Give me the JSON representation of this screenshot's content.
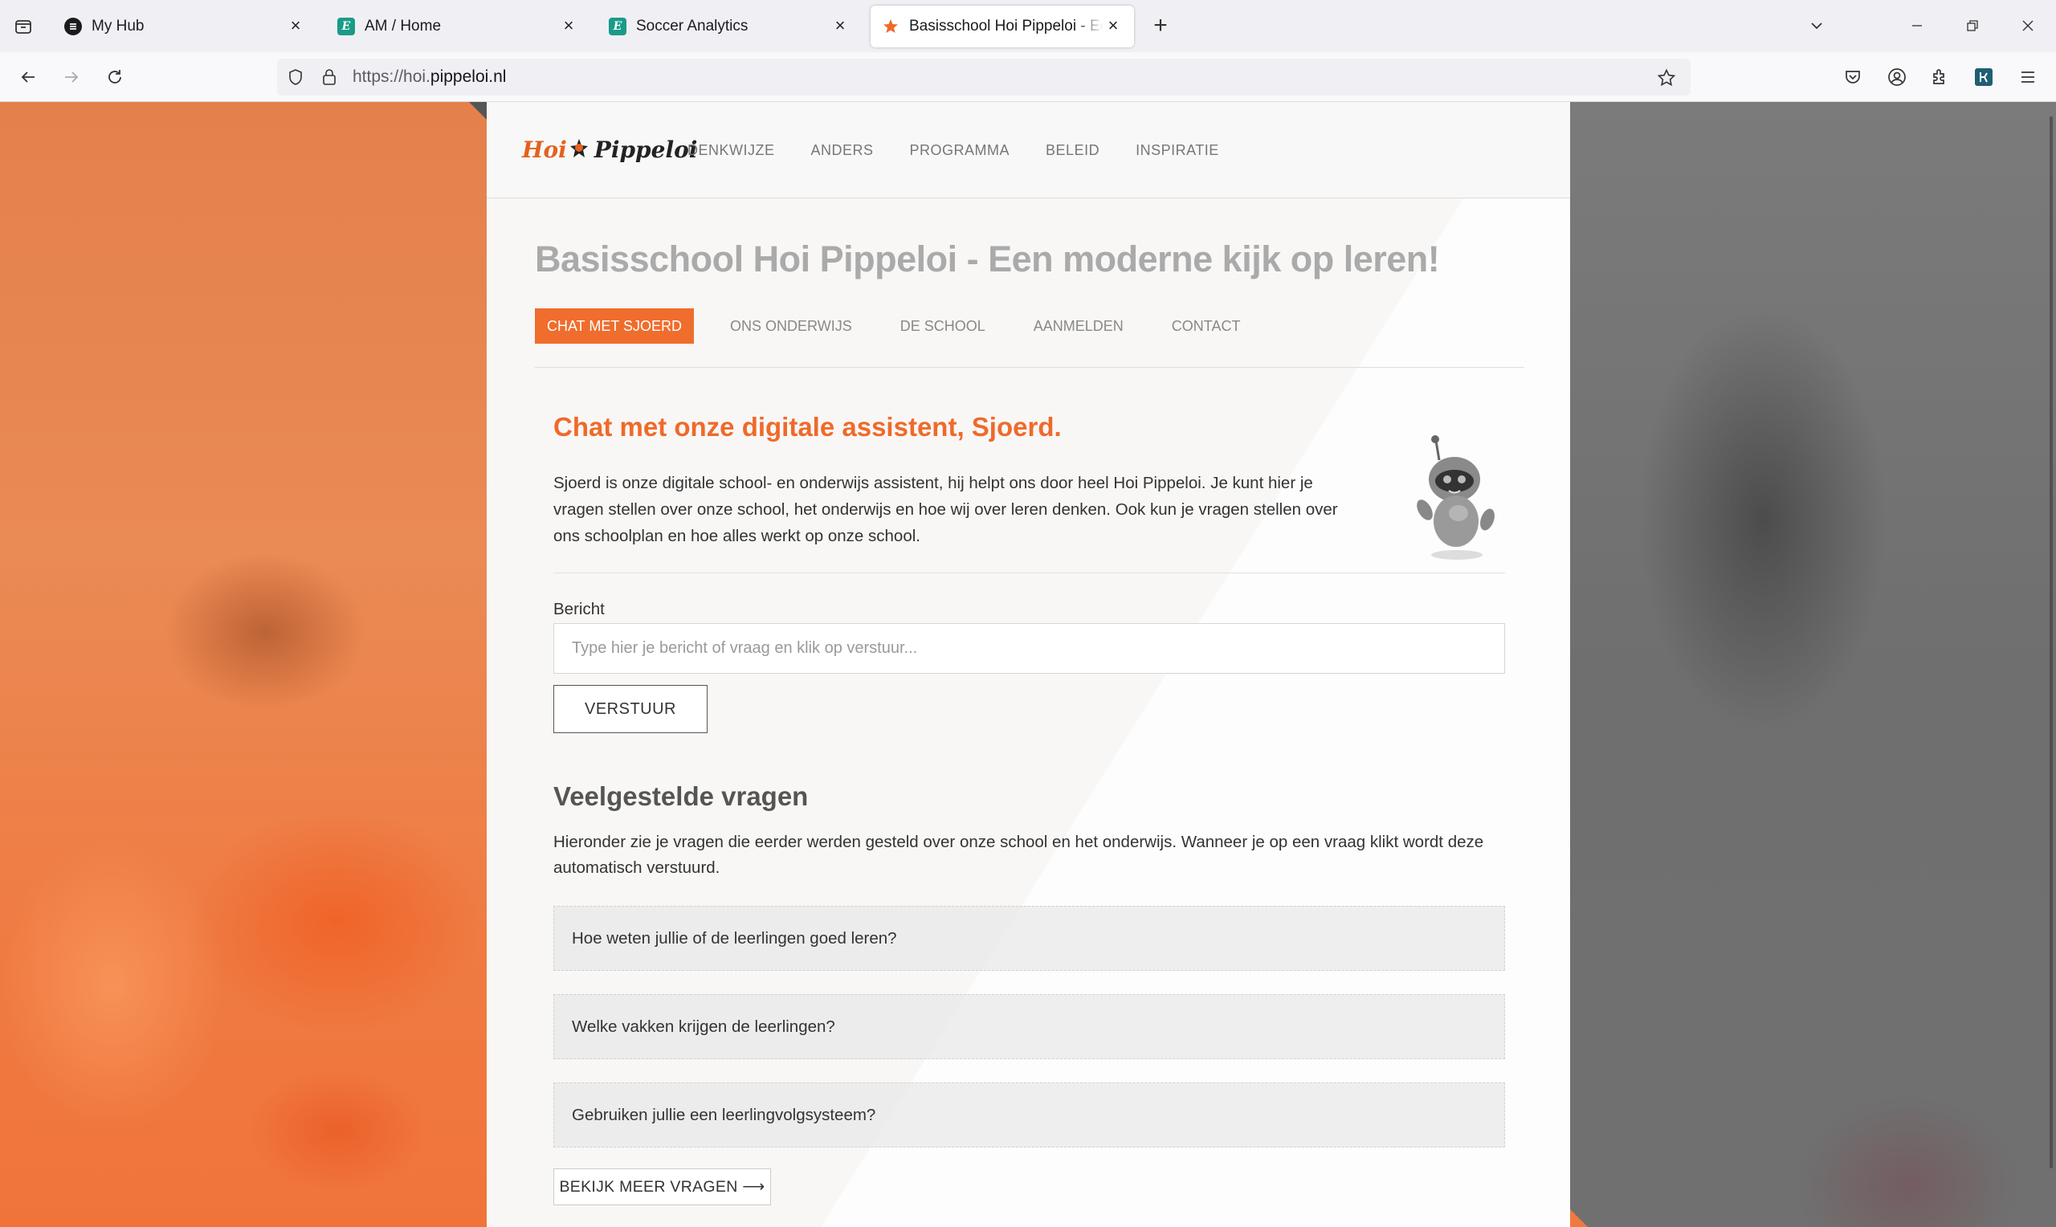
{
  "browser": {
    "tabs": [
      {
        "title": "My Hub",
        "favicon": "hub-icon",
        "favicon_color": "#1b1b1f"
      },
      {
        "title": "AM / Home",
        "favicon": "e-icon",
        "favicon_color": "#1a9b8a"
      },
      {
        "title": "Soccer Analytics",
        "favicon": "e-icon",
        "favicon_color": "#1a9b8a"
      },
      {
        "title": "Basisschool Hoi Pippeloi - Een moderne kijk op leren!",
        "favicon": "pippeloi-icon",
        "favicon_color": "#ef6a2a",
        "active": true
      }
    ],
    "favicon_letters": {
      "e": "E"
    },
    "url_prefix": "https://hoi.",
    "url_domain": "pippeloi.nl"
  },
  "site": {
    "logo": {
      "part1": "Hoi",
      "part2": "Pippeloi"
    },
    "nav": [
      "DENKWIJZE",
      "ANDERS",
      "PROGRAMMA",
      "BELEID",
      "INSPIRATIE"
    ],
    "page_title": "Basisschool Hoi Pippeloi - Een moderne kijk op leren!",
    "subnav": [
      "CHAT MET SJOERD",
      "ONS ONDERWIJS",
      "DE SCHOOL",
      "AANMELDEN",
      "CONTACT"
    ],
    "accent_color": "#ef6a2a"
  },
  "chat": {
    "title": "Chat met onze digitale assistent, Sjoerd.",
    "description": "Sjoerd is onze digitale school- en onderwijs assistent, hij helpt ons door heel Hoi Pippeloi. Je kunt hier je vragen stellen over onze school, het onderwijs en hoe wij over leren denken. Ook kun je vragen stellen over ons schoolplan en hoe alles werkt op onze school.",
    "field_label": "Bericht",
    "input_value": "",
    "input_placeholder": "Type hier je bericht of vraag en klik op verstuur...",
    "send_label": "VERSTUUR"
  },
  "faq": {
    "title": "Veelgestelde vragen",
    "description": "Hieronder zie je vragen die eerder werden gesteld over onze school en het onderwijs. Wanneer je op een vraag klikt wordt deze automatisch verstuurd.",
    "questions": [
      "Hoe weten jullie of de leerlingen goed leren?",
      "Welke vakken krijgen de leerlingen?",
      "Gebruiken jullie een leerlingvolgsysteem?"
    ],
    "more_label": "BEKIJK MEER VRAGEN ⟶"
  }
}
